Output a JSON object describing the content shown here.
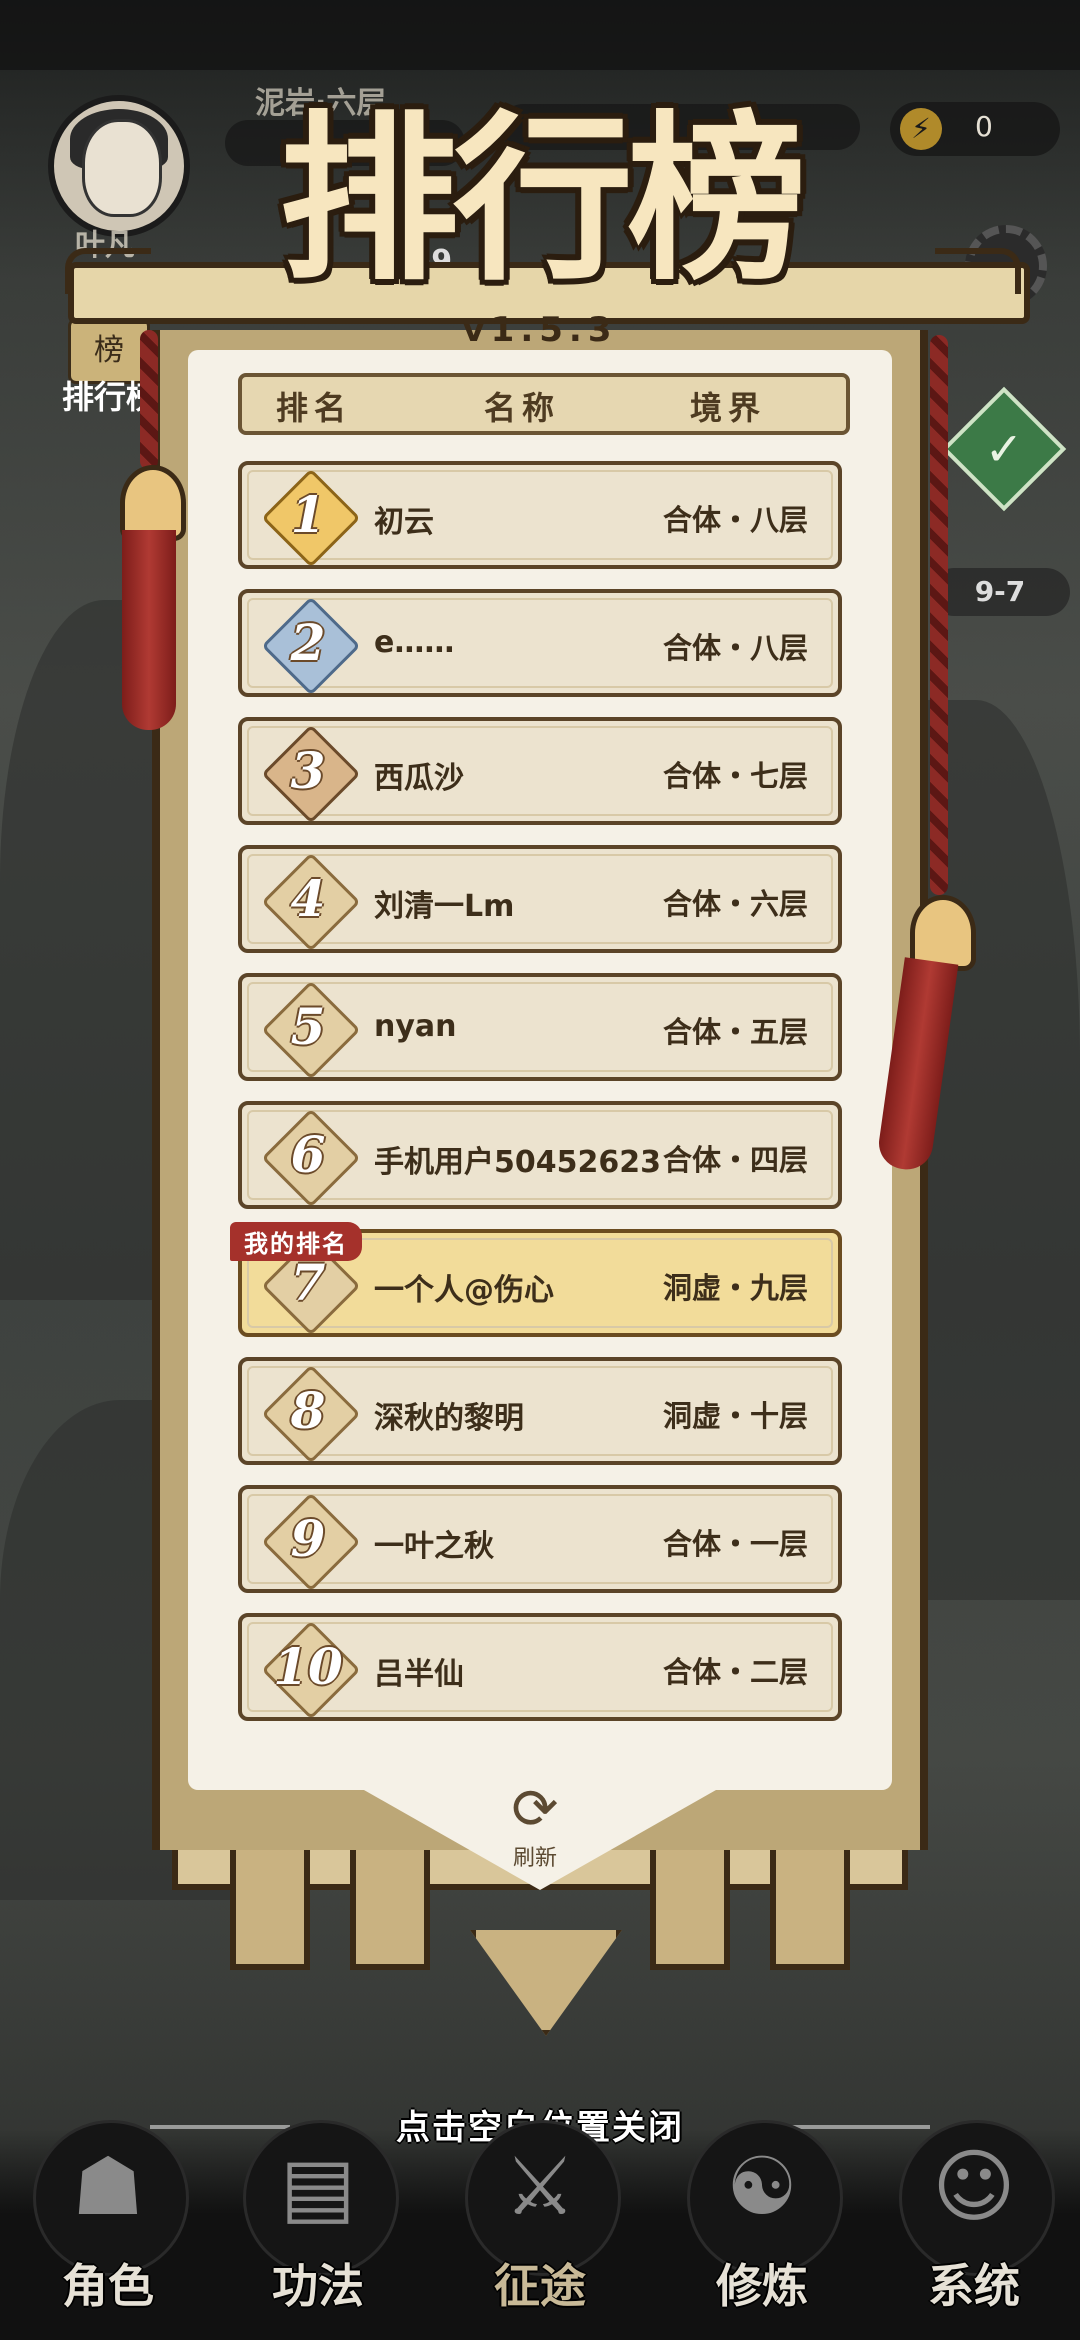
{
  "hud": {
    "zone_text": "泥岩·六层",
    "player_name": "叶凡",
    "rank_shortcut_label": "排行榜",
    "rank_shortcut_icon_text": "榜",
    "stage_left": "9-9",
    "stage_right": "9-7",
    "energy_value": "0"
  },
  "banner": {
    "title": "排行榜",
    "version": "v1.5.3"
  },
  "table": {
    "headers": [
      "排名",
      "名称",
      "境界"
    ],
    "rows": [
      {
        "rank": "1",
        "name": "初云",
        "realm": "合体・八层",
        "medal": "gold"
      },
      {
        "rank": "2",
        "name": "e……",
        "realm": "合体・八层",
        "medal": "silver"
      },
      {
        "rank": "3",
        "name": "西瓜沙",
        "realm": "合体・七层",
        "medal": "bronze"
      },
      {
        "rank": "4",
        "name": "刘清一Lm",
        "realm": "合体・六层",
        "medal": "plain"
      },
      {
        "rank": "5",
        "name": "nyan",
        "realm": "合体・五层",
        "medal": "plain"
      },
      {
        "rank": "6",
        "name": "手机用户50452623",
        "realm": "合体・四层",
        "medal": "plain"
      },
      {
        "rank": "7",
        "name": "一个人@伤心",
        "realm": "洞虚・九层",
        "medal": "plain"
      },
      {
        "rank": "8",
        "name": "深秋的黎明",
        "realm": "洞虚・十层",
        "medal": "plain"
      },
      {
        "rank": "9",
        "name": "一叶之秋",
        "realm": "合体・一层",
        "medal": "plain"
      },
      {
        "rank": "10",
        "name": "吕半仙",
        "realm": "合体・二层",
        "medal": "plain"
      }
    ],
    "my_rank_tag": "我的排名"
  },
  "refresh_label": "刷新",
  "close_hint": "点击空白位置关闭",
  "nav": [
    {
      "label": "角色",
      "icon": "character-icon",
      "glyph": "☗"
    },
    {
      "label": "功法",
      "icon": "scroll-book-icon",
      "glyph": "▤"
    },
    {
      "label": "征途",
      "icon": "sword-icon",
      "glyph": "⚔"
    },
    {
      "label": "修炼",
      "icon": "meditation-icon",
      "glyph": "☯"
    },
    {
      "label": "系统",
      "icon": "system-icon",
      "glyph": "☺"
    }
  ],
  "colors": {
    "banner_cloth": "#f5f1e7",
    "row_bg": "#ece3cf",
    "my_row_bg": "#f2dc9a",
    "tag_red": "#a5312b"
  }
}
